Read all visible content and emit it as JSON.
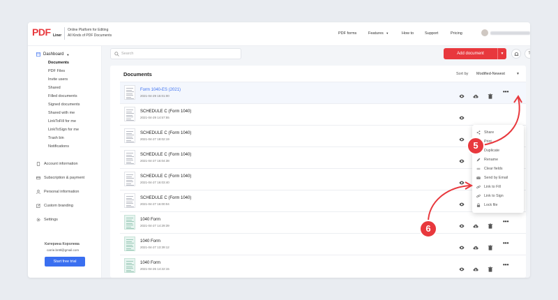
{
  "header": {
    "logo_pdf": "PDF",
    "logo_liner": "Liner",
    "tagline_1": "Online Platform for Editing",
    "tagline_2": "All Kinds of PDF Documents",
    "nav": [
      "PDF forms",
      "Features",
      "How to",
      "Support",
      "Pricing"
    ]
  },
  "sidebar": {
    "dashboard": "Dashboard",
    "sub_items": [
      "Documents",
      "PDF Files",
      "Invite users",
      "Shared",
      "Filled documents",
      "Signed documents",
      "Shared with me",
      "LinkToFill for me",
      "LinkToSign for me",
      "Trash bin",
      "Notifications"
    ],
    "main_items": [
      "Account information",
      "Subscription & payment",
      "Personal information",
      "Custom branding",
      "Settings"
    ],
    "user_name": "Катерина Королева",
    "user_email": "carrie.bn9l@gmail.com",
    "trial_button": "Start free trial"
  },
  "toolbar": {
    "search_placeholder": "Search",
    "add_document": "Add document",
    "help": "?"
  },
  "documents": {
    "title": "Documents",
    "sort_label": "Sort by",
    "sort_value": "Modified-Newest",
    "rows": [
      {
        "name": "Form 1040-ES (2021)",
        "date": "2021-04-29 15:01:00"
      },
      {
        "name": "SCHEDULE C (Form 1040)",
        "date": "2021-04-29 14:57:55"
      },
      {
        "name": "SCHEDULE C (Form 1040)",
        "date": "2021-04-27 18:02:19"
      },
      {
        "name": "SCHEDULE C (Form 1040)",
        "date": "2021-04-27 16:04:38"
      },
      {
        "name": "SCHEDULE C (Form 1040)",
        "date": "2021-04-27 16:03:40"
      },
      {
        "name": "SCHEDULE C (Form 1040)",
        "date": "2021-04-27 16:00:04"
      },
      {
        "name": "1040 Form",
        "date": "2021-04-27 14:29:39"
      },
      {
        "name": "1040 Form",
        "date": "2021-04-27 13:39:12"
      },
      {
        "name": "1040 Form",
        "date": "2021-04-26 14:22:15"
      }
    ]
  },
  "context_menu": {
    "items": [
      "Share",
      "Print",
      "Duplicate",
      "Rename",
      "Clear fields",
      "Send by Email",
      "Link to Fill",
      "Link to Sign",
      "Lock file"
    ]
  },
  "annotations": {
    "step_5": "5",
    "step_6": "6",
    "color": "#e8383d"
  },
  "colors": {
    "brand_red": "#e8383d",
    "accent_blue": "#3a6ff0"
  }
}
